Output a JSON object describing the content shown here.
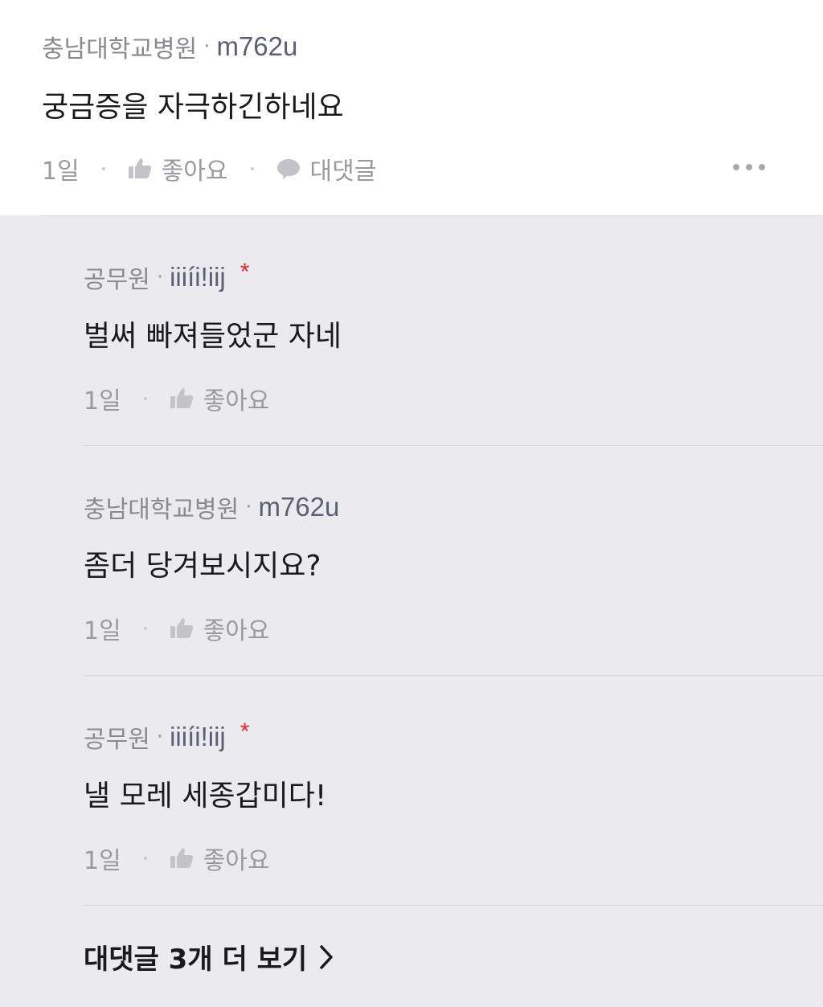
{
  "main_comment": {
    "org": "충남대학교병원",
    "separator": "·",
    "nick": "m762u",
    "text": "궁금증을 자극하긴하네요",
    "time": "1일",
    "like_label": "좋아요",
    "reply_label": "대댓글"
  },
  "replies": [
    {
      "org": "공무원",
      "separator": "·",
      "nick": "iiiíi!iij",
      "star": "*",
      "text": "벌써 빠져들었군 자네",
      "time": "1일",
      "like_label": "좋아요"
    },
    {
      "org": "충남대학교병원",
      "separator": "·",
      "nick": "m762u",
      "text": "좀더 당겨보시지요?",
      "time": "1일",
      "like_label": "좋아요"
    },
    {
      "org": "공무원",
      "separator": "·",
      "nick": "iiiíi!iij",
      "star": "*",
      "text": "낼 모레 세종갑미다!",
      "time": "1일",
      "like_label": "좋아요"
    }
  ],
  "more_replies_label": "대댓글 3개 더 보기",
  "icons": {
    "like": "thumbs-up-icon",
    "reply": "speech-bubble-icon",
    "more": "more-dots-icon",
    "chevron": "chevron-right-icon"
  },
  "colors": {
    "page_bg": "#ebebef",
    "main_bg": "#ffffff",
    "meta_text": "#9a9a9e",
    "nick_text": "#5c5f73",
    "star": "#e52828"
  }
}
